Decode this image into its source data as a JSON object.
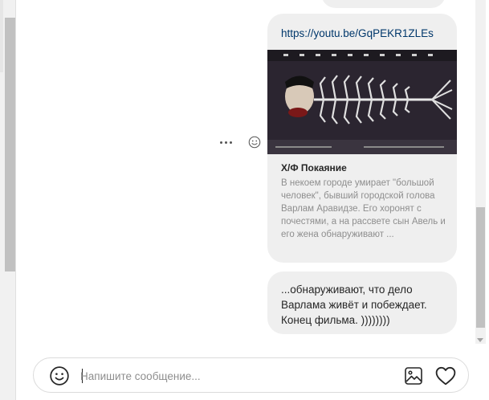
{
  "message_card": {
    "link": "https://youtu.be/GqPEKR1ZLEs",
    "preview_title": "Х/Ф Покаяние",
    "preview_description": "В некоем городе умирает \"большой человек\", бывший городской голова Варлам Аравидзе. Его хоронят с почестями, а на рассвете сын Авель и его жена обнаруживают ...",
    "thumbnail_icon": "fish-skeleton-poster-image"
  },
  "text_message": {
    "text": "...обнаруживают, что дело\nВарлама живёт и побеждает.\nКонец фильма. ))))))))"
  },
  "actions": {
    "more_icon": "more-options-icon",
    "react_icon": "emoji-react-icon"
  },
  "composer": {
    "placeholder": "Напишите сообщение...",
    "value": "",
    "emoji_icon": "emoji-icon",
    "image_icon": "image-icon",
    "heart_icon": "heart-icon"
  },
  "colors": {
    "bubble": "#efefef",
    "link": "#00376b",
    "muted": "#8e8e8e"
  }
}
